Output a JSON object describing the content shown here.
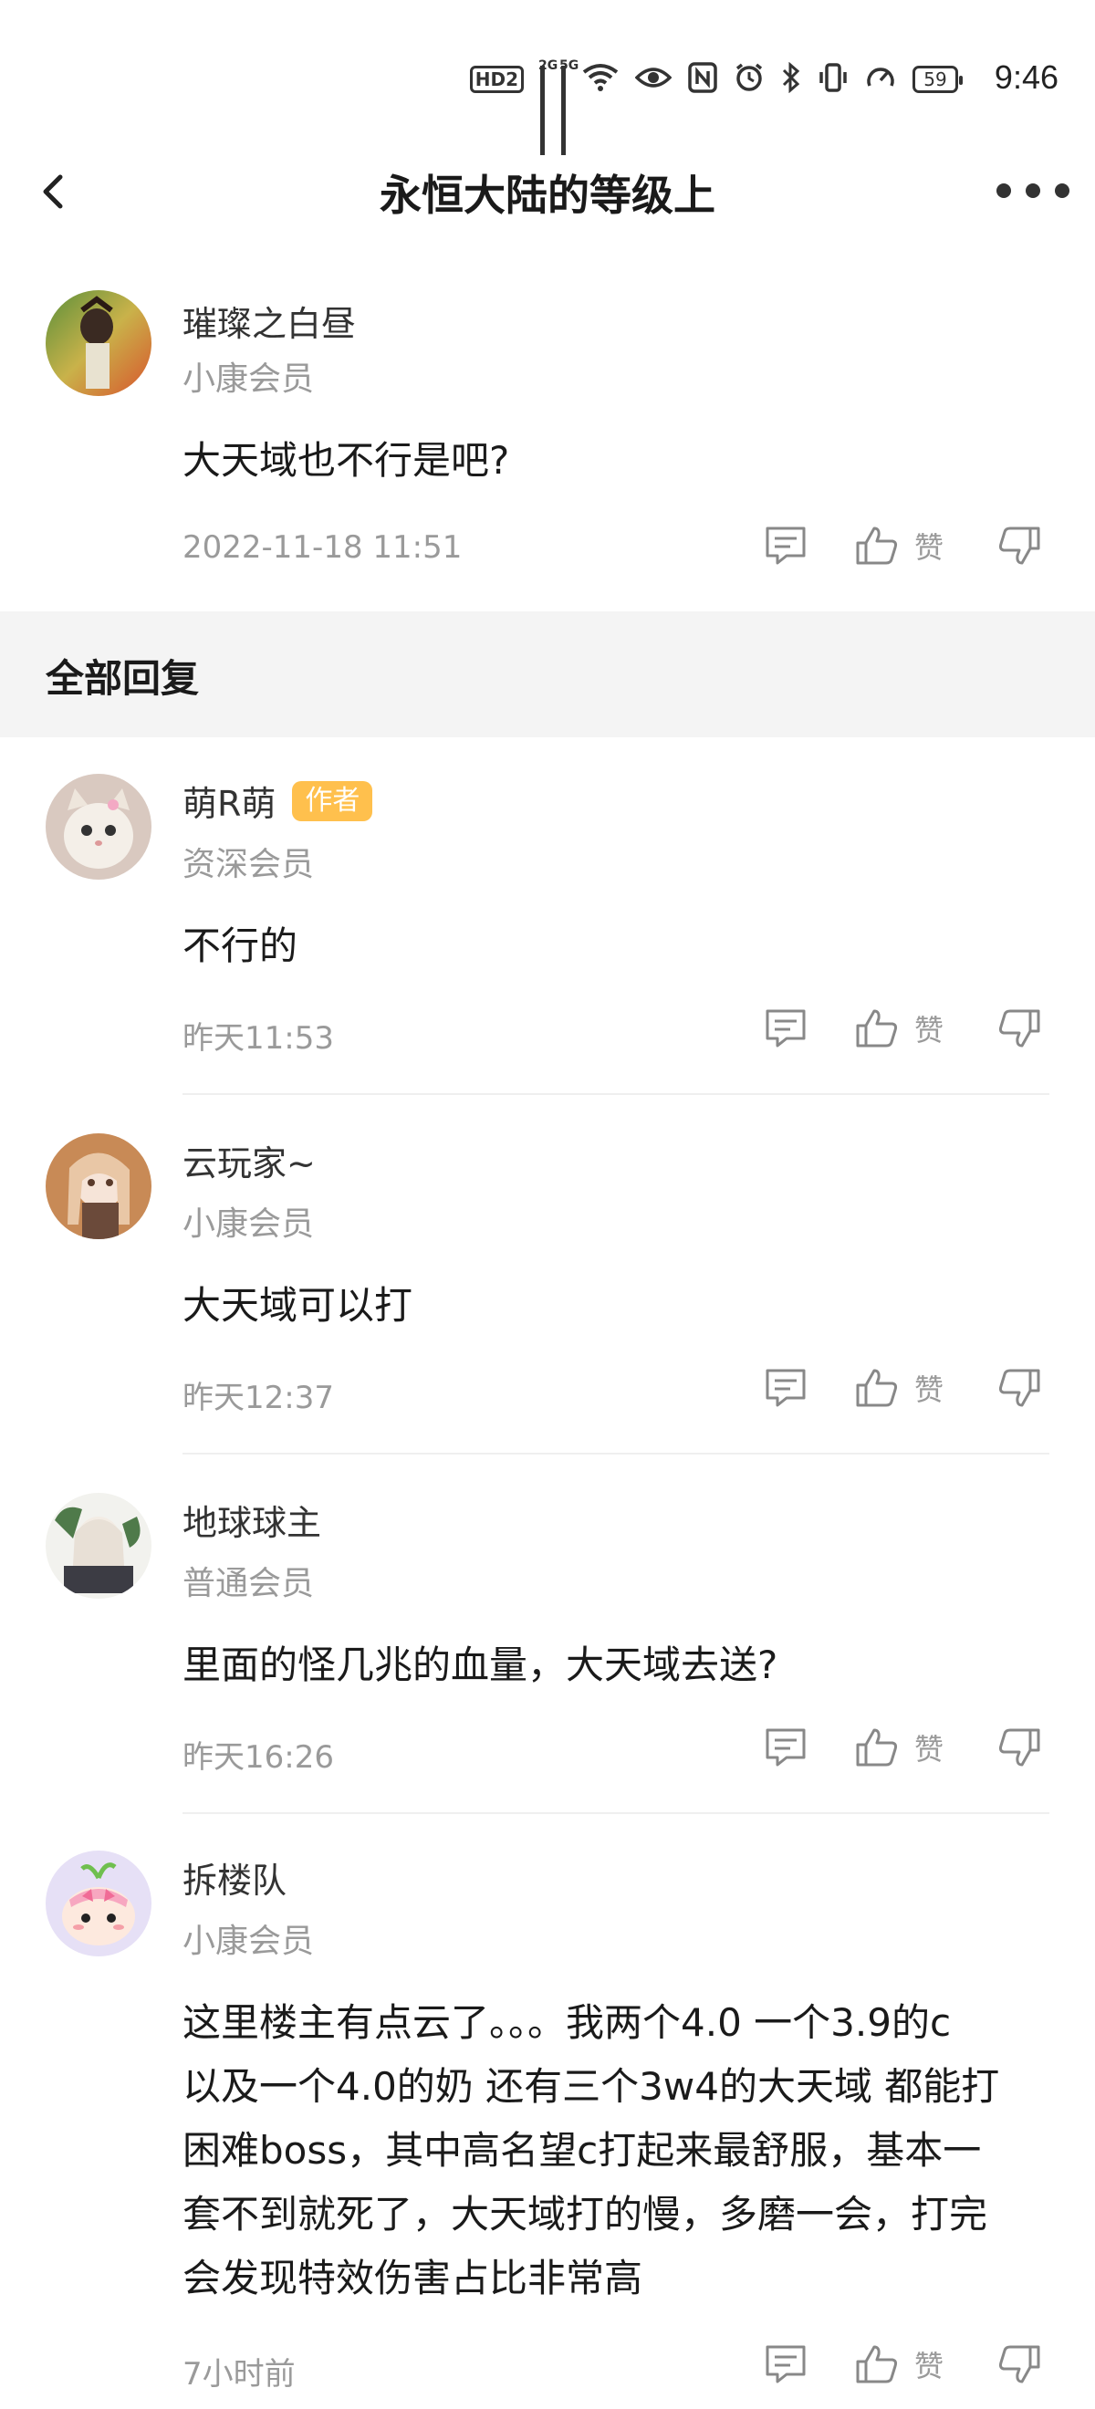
{
  "status_bar": {
    "hd_label": "HD",
    "sim_label": "2",
    "signal1_label": "2G",
    "signal2_label": "5G",
    "battery": "59",
    "time": "9:46"
  },
  "header": {
    "title": "永恒大陆的等级上"
  },
  "original_post": {
    "username": "璀璨之白昼",
    "level": "小康会员",
    "text": "大天域也不行是吧?",
    "time": "2022-11-18 11:51",
    "like_label": "赞"
  },
  "section": {
    "title": "全部回复"
  },
  "replies": [
    {
      "username": "萌R萌",
      "badge": "作者",
      "level": "资深会员",
      "text": "不行的",
      "time": "昨天11:53",
      "like_label": "赞"
    },
    {
      "username": "云玩家~",
      "level": "小康会员",
      "text": "大天域可以打",
      "time": "昨天12:37",
      "like_label": "赞"
    },
    {
      "username": "地球球主",
      "level": "普通会员",
      "text": "里面的怪几兆的血量，大天域去送?",
      "time": "昨天16:26",
      "like_label": "赞"
    },
    {
      "username": "拆楼队",
      "level": "小康会员",
      "text_lines": [
        "这里楼主有点云了。。。我两个4.0 一个3.9的c",
        "以及一个4.0的奶 还有三个3w4的大天域 都能打",
        "困难boss，其中高名望c打起来最舒服，基本一",
        "套不到就死了，大天域打的慢，多磨一会，打完",
        "会发现特效伤害占比非常高"
      ],
      "time": "7小时前",
      "like_label": "赞"
    }
  ],
  "colors": {
    "author_badge": "#ffc04d",
    "meta_text": "#9a9a9a",
    "section_bg": "#f4f4f4"
  }
}
